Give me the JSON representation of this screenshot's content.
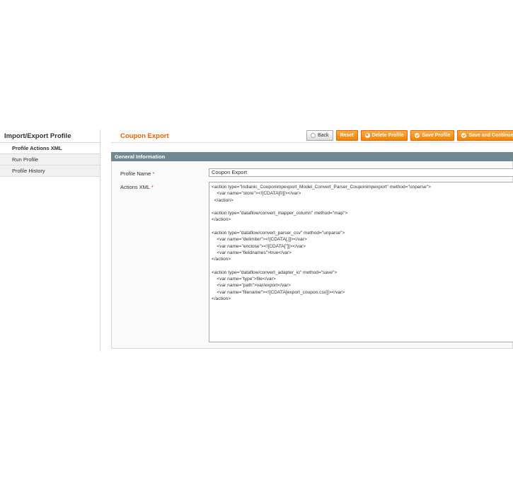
{
  "sidebar": {
    "title": "Import/Export Profile",
    "items": [
      {
        "label": "Profile Actions XML"
      },
      {
        "label": "Run Profile"
      },
      {
        "label": "Profile History"
      }
    ]
  },
  "header": {
    "title": "Coupon Export",
    "buttons": {
      "back": "Back",
      "reset": "Reset",
      "delete": "Delete Profile",
      "save": "Save Profile",
      "save_continue": "Save and Continue"
    }
  },
  "section": {
    "title": "General Information",
    "profile_name_label": "Profile Name",
    "actions_xml_label": "Actions XML",
    "required_mark": "*",
    "profile_name_value": "Coupon Export",
    "actions_xml_value": "<action type=\"Indianic_Couponimpexport_Model_Convert_Parser_Couponimpexport\" method=\"unparse\">\n    <var name=\"store\"><![CDATA[0]]></var>\n  </action>\n\n<action type=\"dataflow/convert_mapper_column\" method=\"map\">\n</action>\n\n<action type=\"dataflow/convert_parser_csv\" method=\"unparse\">\n    <var name=\"delimiter\"><![CDATA[,]]></var>\n    <var name=\"enclose\"><![CDATA[\"]]></var>\n    <var name=\"fieldnames\">true</var>\n</action>\n\n<action type=\"dataflow/convert_adapter_io\" method=\"save\">\n    <var name=\"type\">file</var>\n    <var name=\"path\">var/export</var>\n    <var name=\"filename\"><![CDATA[export_coupon.csv]]></var>\n</action>"
  },
  "colors": {
    "accent": "#eb5e00",
    "button_orange": "#f28200",
    "section_header": "#6f8992"
  }
}
